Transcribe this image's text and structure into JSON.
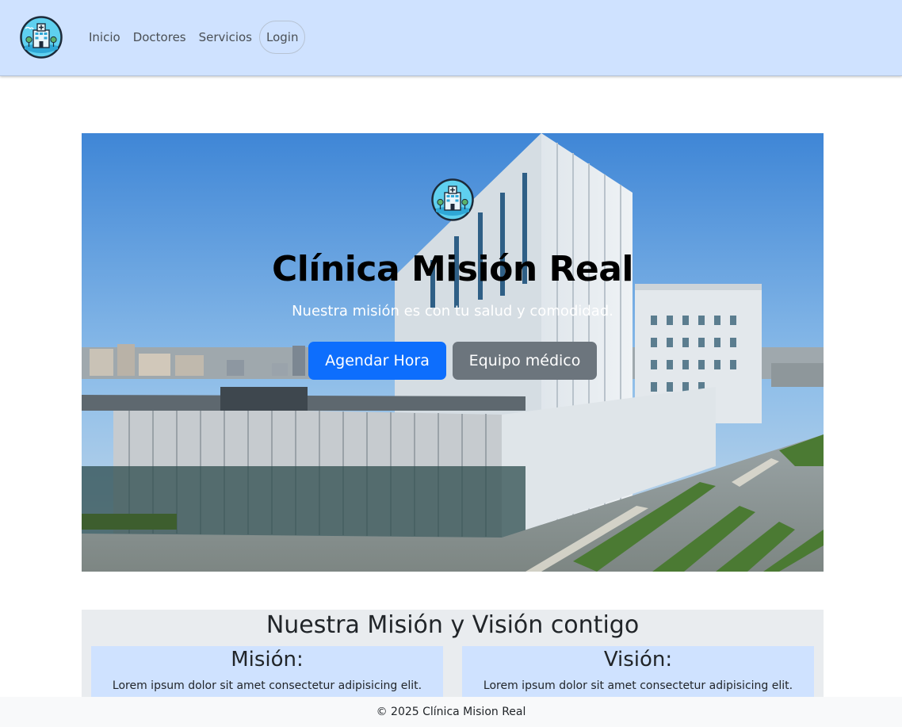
{
  "navbar": {
    "logo_icon": "hospital-logo-icon",
    "links": [
      {
        "label": "Inicio"
      },
      {
        "label": "Doctores"
      },
      {
        "label": "Servicios"
      },
      {
        "label": "Login"
      }
    ]
  },
  "hero": {
    "logo_icon": "hospital-logo-icon",
    "title": "Clínica Misión Real",
    "subtitle": "Nuestra misión es con tu salud y comodidad.",
    "primary_button": "Agendar Hora",
    "secondary_button": "Equipo médico",
    "background": "hospital-building-photo"
  },
  "mission_vision": {
    "title": "Nuestra Misión y Visión contigo",
    "cards": [
      {
        "heading": "Misión:",
        "text": "Lorem ipsum dolor sit amet consectetur adipisicing elit."
      },
      {
        "heading": "Visión:",
        "text": "Lorem ipsum dolor sit amet consectetur adipisicing elit."
      }
    ]
  },
  "footer": {
    "text": "© 2025 Clínica Mision Real"
  },
  "colors": {
    "navbar_bg": "#cfe2ff",
    "primary": "#0d6efd",
    "secondary": "#6c757d",
    "section_bg": "#e9ecef",
    "footer_bg": "#f8f9fa"
  }
}
